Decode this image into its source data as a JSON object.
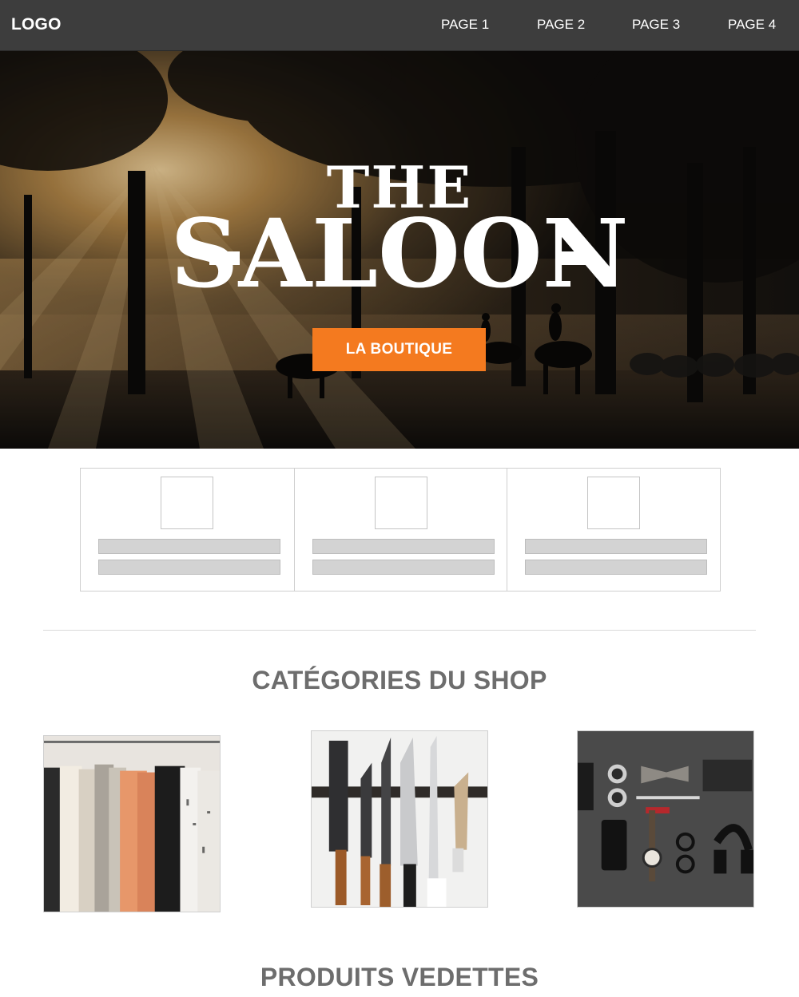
{
  "nav": {
    "logo": "LOGO",
    "links": [
      "PAGE 1",
      "PAGE 2",
      "PAGE 3",
      "PAGE 4"
    ]
  },
  "hero": {
    "title_top": "THE",
    "title_main": "SALOON",
    "cta_label": "LA BOUTIQUE",
    "cta_color": "#f47a1f"
  },
  "features": {
    "count": 3
  },
  "categories": {
    "heading": "CATÉGORIES DU SHOP",
    "tiles": [
      "clothing-rack-photo",
      "kitchen-knives-photo",
      "accessories-flatlay-photo"
    ]
  },
  "featured": {
    "heading": "PRODUITS VEDETTES"
  },
  "colors": {
    "nav_bg": "#3d3d3d",
    "accent": "#f47a1f",
    "heading": "#6d6d6d"
  }
}
